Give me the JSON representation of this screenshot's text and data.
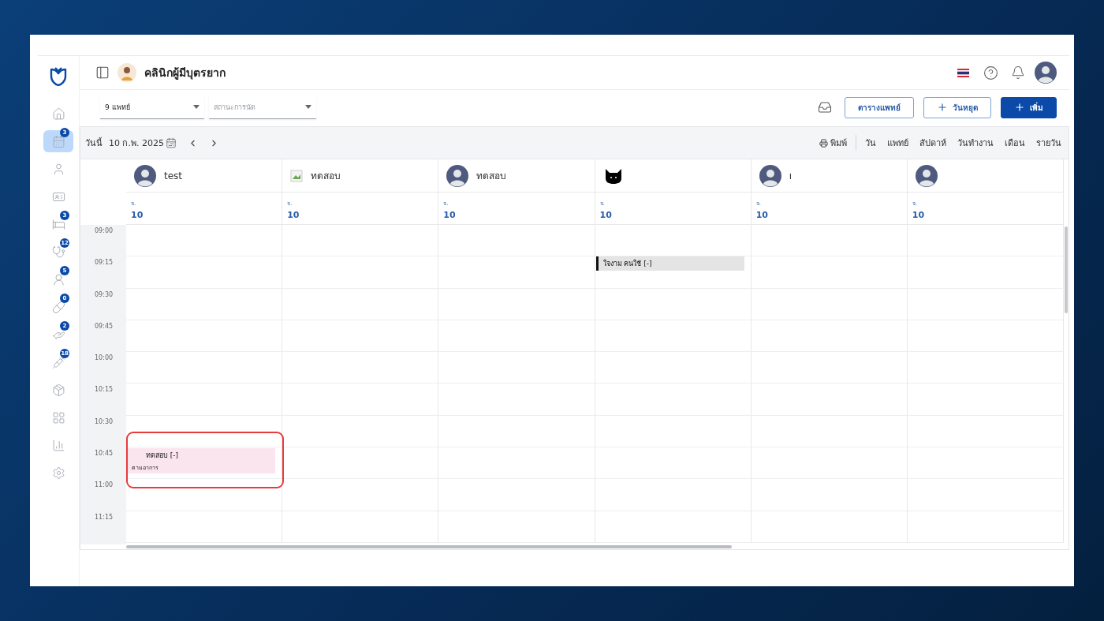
{
  "sidebar": {
    "items": [
      {
        "selected": false
      },
      {
        "selected": true,
        "badge": "3"
      },
      {
        "selected": false
      },
      {
        "selected": false
      },
      {
        "selected": false,
        "badge": "3"
      },
      {
        "selected": false,
        "badge": "12"
      },
      {
        "selected": false,
        "badge": "5"
      },
      {
        "selected": false,
        "badge": "0"
      },
      {
        "selected": false,
        "badge": "2"
      },
      {
        "selected": false,
        "badge": "18"
      },
      {
        "selected": false
      },
      {
        "selected": false
      },
      {
        "selected": false
      },
      {
        "selected": false
      }
    ]
  },
  "header": {
    "title": "คลินิกผู้มีบุตรยาก"
  },
  "filters": [
    {
      "value": "9 แพทย์"
    },
    {
      "placeholder": "สถานะการนัด"
    }
  ],
  "actions": [
    {
      "label": "ตารางแพทย์",
      "kind": "outline"
    },
    {
      "label": "วันหยุด",
      "kind": "outline-add"
    },
    {
      "label": "เพิ่ม",
      "kind": "primary-add"
    }
  ],
  "calendar_bar": {
    "today": "วันนี้",
    "date": "10 ก.พ. 2025",
    "print": "พิมพ์",
    "views": [
      "วัน",
      "แพทย์",
      "สัปดาห์",
      "วันทำงาน",
      "เดือน",
      "รายวัน"
    ]
  },
  "times": [
    "09:00",
    "09:15",
    "09:30",
    "09:45",
    "10:00",
    "10:15",
    "10:30",
    "10:45",
    "11:00",
    "11:15"
  ],
  "doctors": [
    {
      "kind": "person",
      "name": "test",
      "weekday": "จ.",
      "day": "10",
      "slots": [
        {
          "booked": false
        },
        {
          "booked": false
        },
        {
          "booked": false
        },
        {
          "booked": false
        },
        {
          "booked": false
        },
        {
          "booked": false
        },
        {
          "booked": false
        },
        {
          "booked": true,
          "title": "ทดสอบ [-]",
          "note": "ตามอาการ",
          "color": "#fae5ee",
          "highlighted": true
        },
        {
          "booked": false
        },
        {
          "booked": false
        }
      ]
    },
    {
      "kind": "broken",
      "name": "ทดสอบ",
      "weekday": "จ.",
      "day": "10",
      "slots": [
        {
          "booked": false
        },
        {
          "booked": false
        },
        {
          "booked": false
        },
        {
          "booked": false
        },
        {
          "booked": false
        },
        {
          "booked": false
        },
        {
          "booked": false
        },
        {
          "booked": false
        },
        {
          "booked": false
        },
        {
          "booked": false
        }
      ]
    },
    {
      "kind": "person",
      "name": "ทดสอบ",
      "weekday": "จ.",
      "day": "10",
      "slots": [
        {
          "booked": false
        },
        {
          "booked": false
        },
        {
          "booked": false
        },
        {
          "booked": false
        },
        {
          "booked": false
        },
        {
          "booked": false
        },
        {
          "booked": false
        },
        {
          "booked": false
        },
        {
          "booked": false
        },
        {
          "booked": false
        }
      ]
    },
    {
      "kind": "cat",
      "weekday": "จ.",
      "day": "10",
      "slots": [
        {
          "booked": false
        },
        {
          "booked": true,
          "title": "ใจงาม คนใช้ [-]",
          "color": "#e4e4e4",
          "highlighted": false
        },
        {
          "booked": false
        },
        {
          "booked": false
        },
        {
          "booked": false
        },
        {
          "booked": false
        },
        {
          "booked": false
        },
        {
          "booked": false
        },
        {
          "booked": false
        },
        {
          "booked": false
        }
      ]
    },
    {
      "kind": "person",
      "name": "ı",
      "weekday": "จ.",
      "day": "10",
      "slots": [
        {
          "booked": false
        },
        {
          "booked": false
        },
        {
          "booked": false
        },
        {
          "booked": false
        },
        {
          "booked": false
        },
        {
          "booked": false
        },
        {
          "booked": false
        },
        {
          "booked": false
        },
        {
          "booked": false
        },
        {
          "booked": false
        }
      ]
    },
    {
      "kind": "person",
      "weekday": "จ.",
      "day": "10",
      "slots": [
        {
          "booked": false
        },
        {
          "booked": false
        },
        {
          "booked": false
        },
        {
          "booked": false
        },
        {
          "booked": false
        },
        {
          "booked": false
        },
        {
          "booked": false
        },
        {
          "booked": false
        },
        {
          "booked": false
        },
        {
          "booked": false
        }
      ]
    }
  ]
}
